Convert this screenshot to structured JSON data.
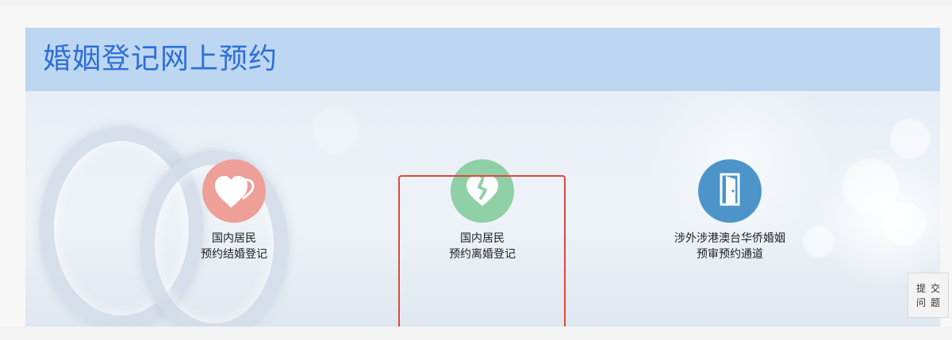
{
  "header": {
    "title": "婚姻登记网上预约"
  },
  "options": [
    {
      "line1": "国内居民",
      "line2": "预约结婚登记",
      "icon": "double-heart-icon",
      "color": "#ee9f98"
    },
    {
      "line1": "国内居民",
      "line2": "预约离婚登记",
      "icon": "broken-heart-icon",
      "color": "#8fd0a6"
    },
    {
      "line1": "涉外涉港澳台华侨婚姻",
      "line2": "预审预约通道",
      "icon": "door-icon",
      "color": "#4c94c9"
    }
  ],
  "highlight": {
    "color": "#e1463a"
  },
  "feedback": {
    "line1": "提交",
    "line2": "问题"
  }
}
